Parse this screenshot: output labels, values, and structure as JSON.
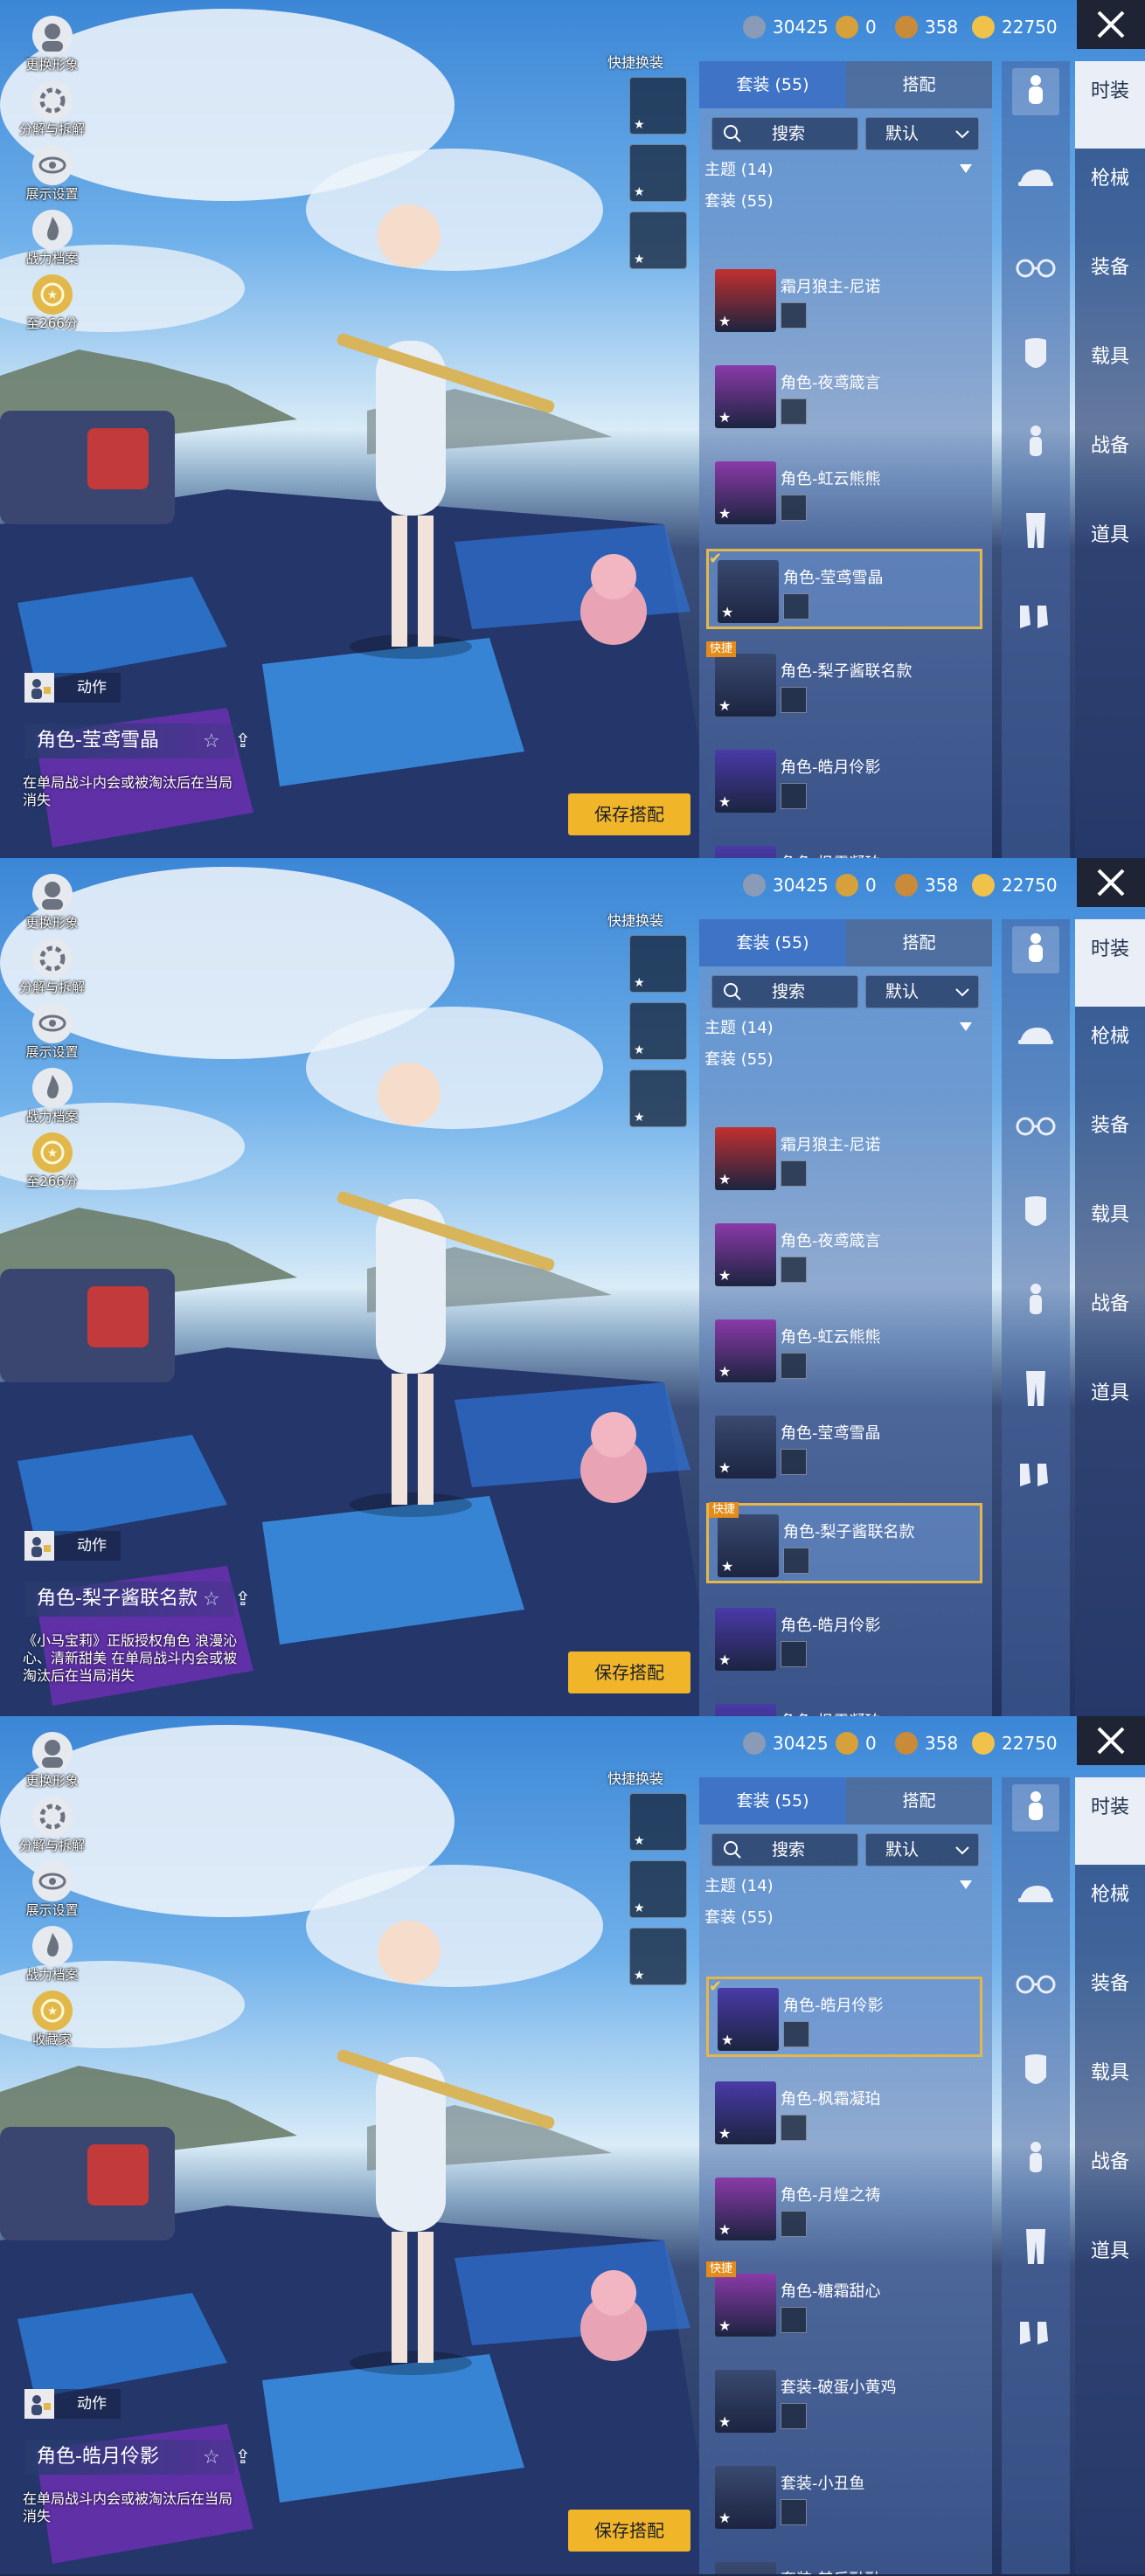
{
  "currencies": [
    {
      "icon": "coin-silver-icon",
      "value": "30425",
      "color": "#8a9bb8"
    },
    {
      "icon": "coupon-icon",
      "value": "0",
      "color": "#d6a13a"
    },
    {
      "icon": "badge-icon",
      "value": "358",
      "color": "#c98a3a"
    },
    {
      "icon": "lightning-coin-icon",
      "value": "22750",
      "color": "#f0c24a"
    }
  ],
  "left_menu": [
    {
      "icon": "avatar-icon",
      "label": "更换形象"
    },
    {
      "icon": "decompose-icon",
      "label": "分解与拆解"
    },
    {
      "icon": "eye-icon",
      "label": "展示设置"
    },
    {
      "icon": "flame-icon",
      "label": "战力档案"
    }
  ],
  "quick_change_label": "快捷换装",
  "tabs": {
    "outfits": "套装 (55)",
    "match": "搭配"
  },
  "search_label": "搜索",
  "sort_label": "默认",
  "theme_label": "主题 (14)",
  "set_label": "套装 (55)",
  "save_button": "保存搭配",
  "action_label": "动作",
  "quick_badge": "快捷",
  "side_tabs": [
    "时装",
    "枪械",
    "装备",
    "载具",
    "战备",
    "道具"
  ],
  "panels": [
    {
      "level_text": "至266分",
      "role_name": "角色-莹鸢雪晶",
      "role_desc": "在单局战斗内会或被淘汰后在当局消失",
      "outfits": [
        {
          "name": "霜月狼主-尼诺",
          "thumb": "#c23030",
          "selected": false,
          "quick": false
        },
        {
          "name": "角色-夜鸢箴言",
          "thumb": "#8a3aa8",
          "selected": false,
          "quick": false
        },
        {
          "name": "角色-虹云熊熊",
          "thumb": "#8a3aa8",
          "selected": false,
          "quick": false
        },
        {
          "name": "角色-莹鸢雪晶",
          "thumb": "#3a4a70",
          "selected": true,
          "quick": false
        },
        {
          "name": "角色-梨子酱联名款",
          "thumb": "#3a4a70",
          "selected": false,
          "quick": true
        },
        {
          "name": "角色-皓月伶影",
          "thumb": "#4a3aa8",
          "selected": false,
          "quick": false
        },
        {
          "name": "角色-枫霜凝珀",
          "thumb": "#4a3aa8",
          "selected": false,
          "quick": false
        }
      ]
    },
    {
      "level_text": "至266分",
      "role_name": "角色-梨子酱联名款",
      "role_desc": "《小马宝莉》正版授权角色 浪漫沁心、清新甜美 在单局战斗内会或被淘汰后在当局消失",
      "outfits": [
        {
          "name": "霜月狼主-尼诺",
          "thumb": "#c23030",
          "selected": false,
          "quick": false
        },
        {
          "name": "角色-夜鸢箴言",
          "thumb": "#8a3aa8",
          "selected": false,
          "quick": false
        },
        {
          "name": "角色-虹云熊熊",
          "thumb": "#8a3aa8",
          "selected": false,
          "quick": false
        },
        {
          "name": "角色-莹鸢雪晶",
          "thumb": "#3a4a70",
          "selected": false,
          "quick": false
        },
        {
          "name": "角色-梨子酱联名款",
          "thumb": "#3a4a70",
          "selected": true,
          "quick": true
        },
        {
          "name": "角色-皓月伶影",
          "thumb": "#4a3aa8",
          "selected": false,
          "quick": false
        },
        {
          "name": "角色-枫霜凝珀",
          "thumb": "#4a3aa8",
          "selected": false,
          "quick": false
        }
      ]
    },
    {
      "level_text": "收藏家",
      "role_name": "角色-皓月伶影",
      "role_desc": "在单局战斗内会或被淘汰后在当局消失",
      "outfits": [
        {
          "name": "角色-皓月伶影",
          "thumb": "#4a3aa8",
          "selected": true,
          "quick": false
        },
        {
          "name": "角色-枫霜凝珀",
          "thumb": "#4a3aa8",
          "selected": false,
          "quick": false
        },
        {
          "name": "角色-月煌之祷",
          "thumb": "#8a3aa8",
          "selected": false,
          "quick": false
        },
        {
          "name": "角色-糖霜甜心",
          "thumb": "#8a3aa8",
          "selected": false,
          "quick": true
        },
        {
          "name": "套装-破蛋小黄鸡",
          "thumb": "#3a4a70",
          "selected": false,
          "quick": false
        },
        {
          "name": "套装-小丑鱼",
          "thumb": "#3a4a70",
          "selected": false,
          "quick": false
        },
        {
          "name": "套装-其乐融融",
          "thumb": "#3a4a70",
          "selected": false,
          "quick": false
        }
      ]
    }
  ]
}
